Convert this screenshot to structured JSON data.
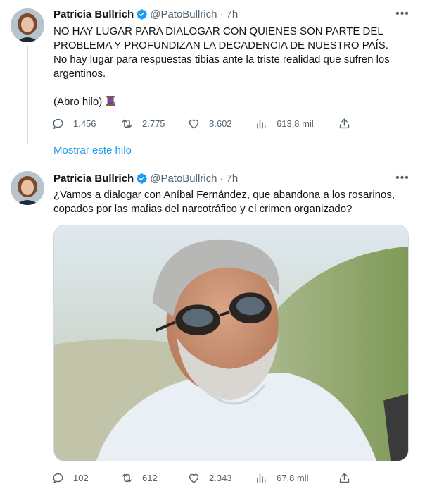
{
  "colors": {
    "text": "#0f1419",
    "secondary": "#536471",
    "link": "#1d9bf0",
    "verified": "#1d9bf0",
    "divider": "#cfd9de"
  },
  "tweets": [
    {
      "author": {
        "name": "Patricia Bullrich",
        "handle": "@PatoBullrich",
        "time": "7h"
      },
      "text": "NO HAY LUGAR PARA DIALOGAR CON QUIENES SON PARTE DEL PROBLEMA Y PROFUNDIZAN LA DECADENCIA DE NUESTRO PAÍS.\nNo hay lugar para respuestas tibias ante la triste realidad que sufren los argentinos.\n\n(Abro hilo)",
      "emoji": "spool-of-thread-icon",
      "stats": {
        "replies": "1.456",
        "retweets": "2.775",
        "likes": "8.602",
        "views": "613,8 mil"
      }
    },
    {
      "author": {
        "name": "Patricia Bullrich",
        "handle": "@PatoBullrich",
        "time": "7h"
      },
      "text": "¿Vamos a dialogar con Aníbal Fernández, que abandona a los rosarinos, copados por las mafias del narcotráfico y el crimen organizado?",
      "media": "photo-man-with-sunglasses",
      "stats": {
        "replies": "102",
        "retweets": "612",
        "likes": "2.343",
        "views": "67,8 mil"
      }
    }
  ],
  "thread": {
    "show_thread_label": "Mostrar este hilo"
  }
}
